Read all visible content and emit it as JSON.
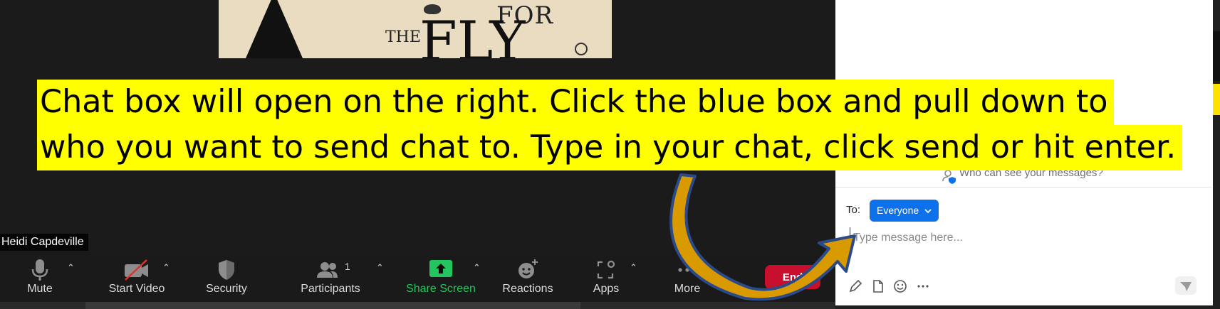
{
  "shared_content": {
    "title_word_for": "FOR",
    "title_word_the": "THE",
    "title_word_fly": "FLY"
  },
  "participant": {
    "name": "Heidi Capdeville"
  },
  "toolbar": {
    "mute": "Mute",
    "start_video": "Start Video",
    "security": "Security",
    "participants": "Participants",
    "participants_count": "1",
    "share_screen": "Share Screen",
    "reactions": "Reactions",
    "apps": "Apps",
    "more": "More",
    "end": "End"
  },
  "chat": {
    "who_can_see": "Who can see your messages?",
    "to_label": "To:",
    "recipient": "Everyone",
    "placeholder": "Type message here..."
  },
  "callout": {
    "line1": "Chat box will open on the right. Click the blue box and pull down to",
    "line2": "who you want to send chat to. Type in your chat, click send or hit enter."
  },
  "colors": {
    "highlight": "#ffff00",
    "share_green": "#22c55e",
    "end_red": "#c8102e",
    "zoom_blue": "#0e71eb",
    "arrow_gold": "#d99a00",
    "arrow_outline": "#2b4a8a"
  }
}
